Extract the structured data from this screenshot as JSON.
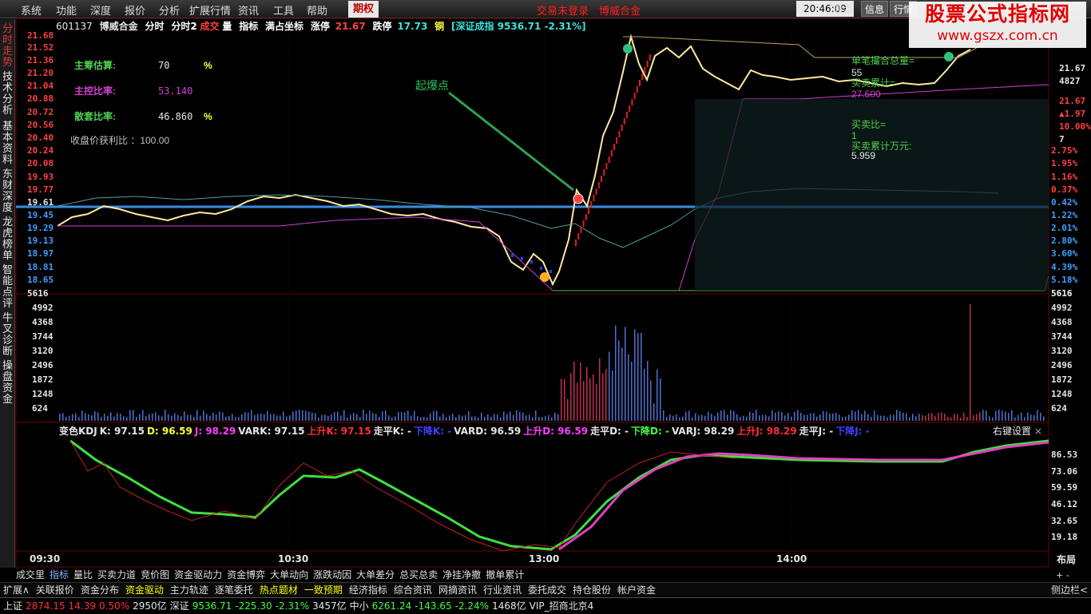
{
  "menu": {
    "items": [
      "系统",
      "功能",
      "深度",
      "报价",
      "分析",
      "扩展行情",
      "资讯",
      "工具",
      "帮助"
    ],
    "qihuo": "期权",
    "notice": "交易未登录　博威合金",
    "clock": "20:46:09",
    "weekday": "周六",
    "info": "信息",
    "quote": "行情"
  },
  "watermark": {
    "line1": "股票公式指标网",
    "line2": "www.gszx.com.cn"
  },
  "sidebar": [
    "分时走势",
    "技术分析",
    "基本资料",
    "东财深度",
    "龙虎榜单",
    "智能点评",
    "牛叉诊断",
    "操盘资金"
  ],
  "header": {
    "code": "601137",
    "name": "博威合金",
    "views": [
      "分时",
      "分时2"
    ],
    "chengjiao": "成交",
    "liang": "量",
    "rest": [
      "指标",
      "满占坐标"
    ],
    "zhangting_label": "涨停",
    "zhangting": "21.67",
    "dieting_label": "跌停",
    "dieting": "17.73",
    "tong": "铜",
    "index": "[深证成指 9536.71 -2.31%]"
  },
  "left_stats": [
    {
      "label": "主筹估算:",
      "value": "70",
      "unit": "%"
    },
    {
      "label": "主控比率:",
      "value": "53.140",
      "unit": ""
    },
    {
      "label": "散套比率:",
      "value": "46.860",
      "unit": "%"
    }
  ],
  "close_profit": "收盘价获利比 ：100.00",
  "annotation": "起爆点",
  "right_stats": {
    "l1": "单笔撮合总量=",
    "v1": "55",
    "l2": "买卖累计=",
    "v2": "27.500",
    "l3": "买卖比=",
    "v3": "1",
    "l4": "买卖累计万元:",
    "v4": "5.959"
  },
  "price_axis_left": [
    "21.68",
    "21.52",
    "21.36",
    "21.20",
    "21.04",
    "20.88",
    "20.72",
    "20.56",
    "20.40",
    "20.24",
    "20.08",
    "19.93",
    "19.77",
    "19.61",
    "19.45",
    "19.29",
    "19.13",
    "18.97",
    "18.81",
    "18.65",
    "5616"
  ],
  "pct_axis_right": [
    "",
    "",
    "",
    "",
    "",
    "",
    "",
    "",
    "",
    "2.75%",
    "1.95%",
    "1.16%",
    "0.37%",
    "0.42%",
    "1.22%",
    "2.01%",
    "2.80%",
    "3.60%",
    "4.39%",
    "5.18%",
    "5616"
  ],
  "right_top": [
    "21.67",
    "4827",
    "21.67",
    "▲1.97",
    "10.00%",
    "7"
  ],
  "vol_axis": [
    "4992",
    "4368",
    "3744",
    "3120",
    "2496",
    "1872",
    "1248",
    "624"
  ],
  "kdj_axis": [
    "86.53",
    "73.06",
    "59.59",
    "46.12",
    "32.65",
    "19.18"
  ],
  "kdj_header": [
    {
      "t": "变色KDJ",
      "c": "#e6e6e6"
    },
    {
      "t": "K: 97.15",
      "c": "#e6e6e6"
    },
    {
      "t": "D: 96.59",
      "c": "#ffff40"
    },
    {
      "t": "J: 98.29",
      "c": "#ff40ff"
    },
    {
      "t": "VARK: 97.15",
      "c": "#e6e6e6"
    },
    {
      "t": "上升K: 97.15",
      "c": "#ff3030"
    },
    {
      "t": "走平K: -",
      "c": "#e6e6e6"
    },
    {
      "t": "下降K: -",
      "c": "#4040ff"
    },
    {
      "t": "VARD: 96.59",
      "c": "#e6e6e6"
    },
    {
      "t": "上升D: 96.59",
      "c": "#ff40ff"
    },
    {
      "t": "走平D: -",
      "c": "#e6e6e6"
    },
    {
      "t": "下降D: -",
      "c": "#40ff40"
    },
    {
      "t": "VARJ: 98.29",
      "c": "#e6e6e6"
    },
    {
      "t": "上升J: 98.29",
      "c": "#ff3030"
    },
    {
      "t": "走平J: -",
      "c": "#e6e6e6"
    },
    {
      "t": "下降J: -",
      "c": "#4040ff"
    }
  ],
  "right_settings": "右键设置",
  "time_axis": [
    "09:30",
    "10:30",
    "13:00",
    "14:00"
  ],
  "layout_btn": "布局",
  "tabs1": [
    "成交里",
    "指标",
    "量比",
    "买卖力道",
    "竞价图",
    "资金驱动力",
    "资金博弈",
    "大单动向",
    "涨跌动因",
    "大单差分",
    "总买总卖",
    "净挂净撤",
    "撤单累计"
  ],
  "tabs1_selected": 1,
  "tabs2": [
    "扩展∧",
    "关联报价",
    "资金分布",
    "资金驱动",
    "主力轨迹",
    "逐笔委托",
    "热点题材",
    "一致预期",
    "经济指标",
    "综合资讯",
    "网摘资讯",
    "行业资讯",
    "委托成交",
    "持仓股份",
    "帐户资金"
  ],
  "tabs2_highlight": [
    3,
    6,
    7
  ],
  "pm": "+ -",
  "sidebar_toggle": "侧边栏<",
  "status": [
    {
      "t": "上证",
      "c": "#e6e6e6"
    },
    {
      "t": "2874.15",
      "c": "#ff3030"
    },
    {
      "t": "14.39",
      "c": "#ff3030"
    },
    {
      "t": "0.50%",
      "c": "#ff3030"
    },
    {
      "t": "2950亿",
      "c": "#e6e6e6"
    },
    {
      "t": "深证",
      "c": "#e6e6e6"
    },
    {
      "t": "9536.71",
      "c": "#40ff40"
    },
    {
      "t": "-225.30",
      "c": "#40ff40"
    },
    {
      "t": "-2.31%",
      "c": "#40ff40"
    },
    {
      "t": "3457亿",
      "c": "#e6e6e6"
    },
    {
      "t": "中小",
      "c": "#e6e6e6"
    },
    {
      "t": "6261.24",
      "c": "#40ff40"
    },
    {
      "t": "-143.65",
      "c": "#40ff40"
    },
    {
      "t": "-2.24%",
      "c": "#40ff40"
    },
    {
      "t": "1468亿",
      "c": "#e6e6e6"
    },
    {
      "t": "VIP_招商北京4",
      "c": "#e6e6e6"
    }
  ]
}
